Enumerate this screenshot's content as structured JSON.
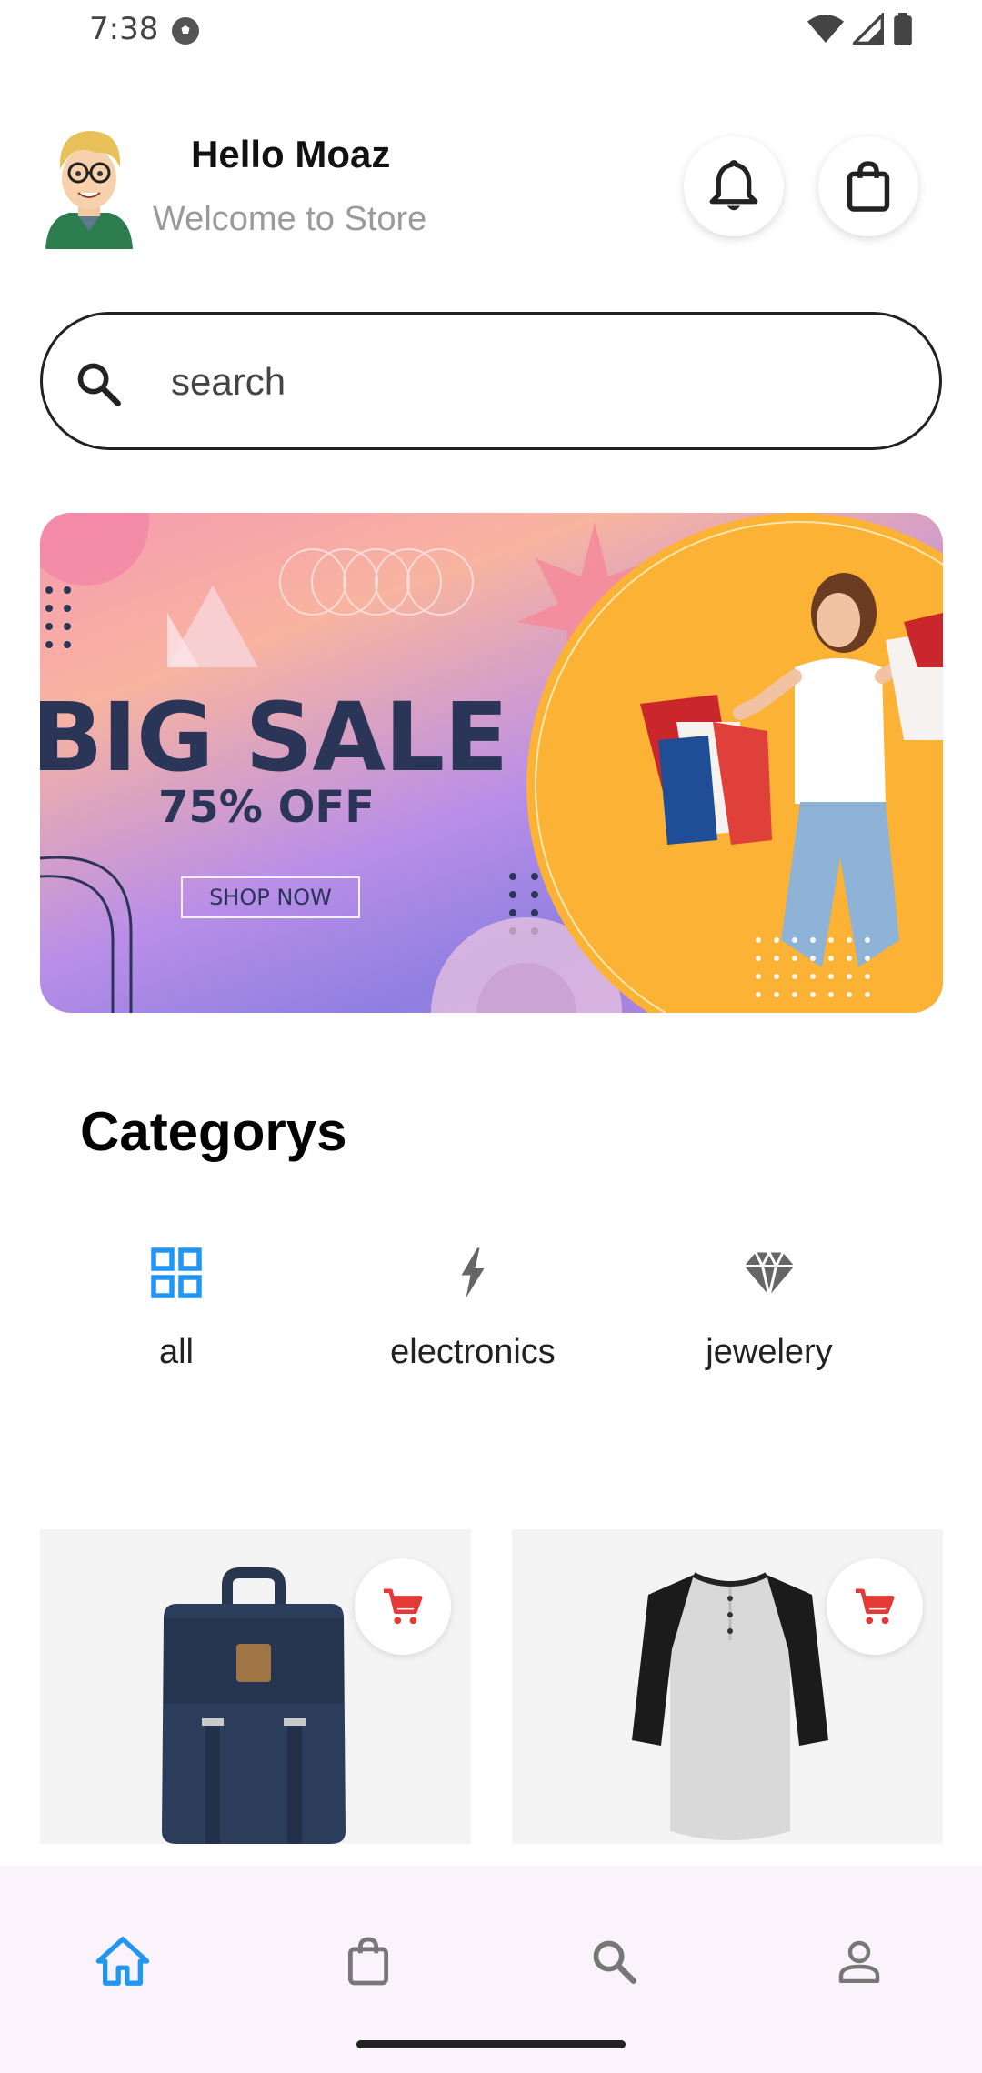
{
  "status_bar": {
    "time": "7:38",
    "icons": [
      "soccer-ball-icon",
      "wifi-icon",
      "signal-icon",
      "battery-icon"
    ]
  },
  "header": {
    "greeting": "Hello Moaz",
    "subtitle": "Welcome to Store",
    "buttons": [
      "bell-icon",
      "shopping-bag-icon"
    ]
  },
  "search": {
    "placeholder": "search"
  },
  "banner": {
    "headline": "BIG SALE",
    "discount": "75% OFF",
    "cta": "SHOP NOW"
  },
  "categories": {
    "title": "Categorys",
    "items": [
      {
        "label": "all",
        "icon": "grid-icon",
        "selected": true
      },
      {
        "label": "electronics",
        "icon": "bolt-icon",
        "selected": false
      },
      {
        "label": "jewelery",
        "icon": "diamond-icon",
        "selected": false
      }
    ]
  },
  "products": [
    {
      "name": "backpack",
      "cart_icon": "add-to-cart-icon"
    },
    {
      "name": "raglan t-shirt",
      "cart_icon": "add-to-cart-icon"
    }
  ],
  "bottom_nav": {
    "items": [
      {
        "icon": "home-icon",
        "active": true
      },
      {
        "icon": "bag-icon",
        "active": false
      },
      {
        "icon": "search-icon",
        "active": false
      },
      {
        "icon": "profile-icon",
        "active": false
      }
    ]
  },
  "colors": {
    "accent": "#2196f3",
    "cart": "#e53935",
    "text_muted": "#9a9a9a",
    "banner_text": "#2a3557",
    "nav_background": "#fbf3fb"
  }
}
